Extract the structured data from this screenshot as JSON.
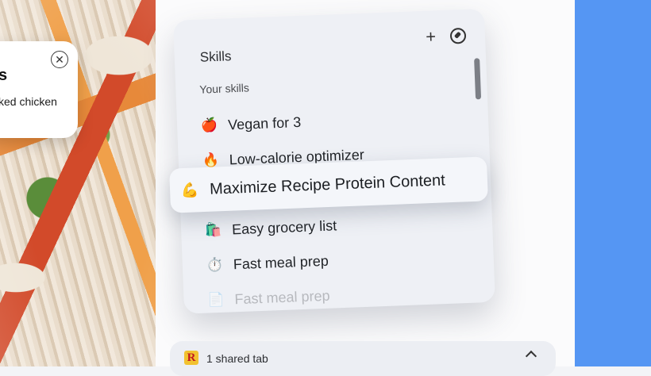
{
  "floating_card": {
    "title_fragment": "s",
    "text_fragment": "ked chicken"
  },
  "skills_popup": {
    "title": "Skills",
    "section_label": "Your skills",
    "items": [
      {
        "icon": "🍎",
        "label": "Vegan for 3"
      },
      {
        "icon": "🔥",
        "label": "Low-calorie optimizer"
      },
      {
        "icon": "💪",
        "label": "Maximize Recipe Protein Content"
      },
      {
        "icon": "🛍️",
        "label": "Easy grocery list"
      },
      {
        "icon": "⏱️",
        "label": "Fast meal prep"
      },
      {
        "icon": "📄",
        "label": "Fast meal prep"
      }
    ],
    "add_icon": "+",
    "compass_icon": "compass-icon"
  },
  "shared_tabs": {
    "badge": "R",
    "label": "1 shared tab"
  },
  "colors": {
    "accent_blue": "#5596f3",
    "badge_yellow": "#f2c230",
    "badge_red": "#c2191f"
  }
}
